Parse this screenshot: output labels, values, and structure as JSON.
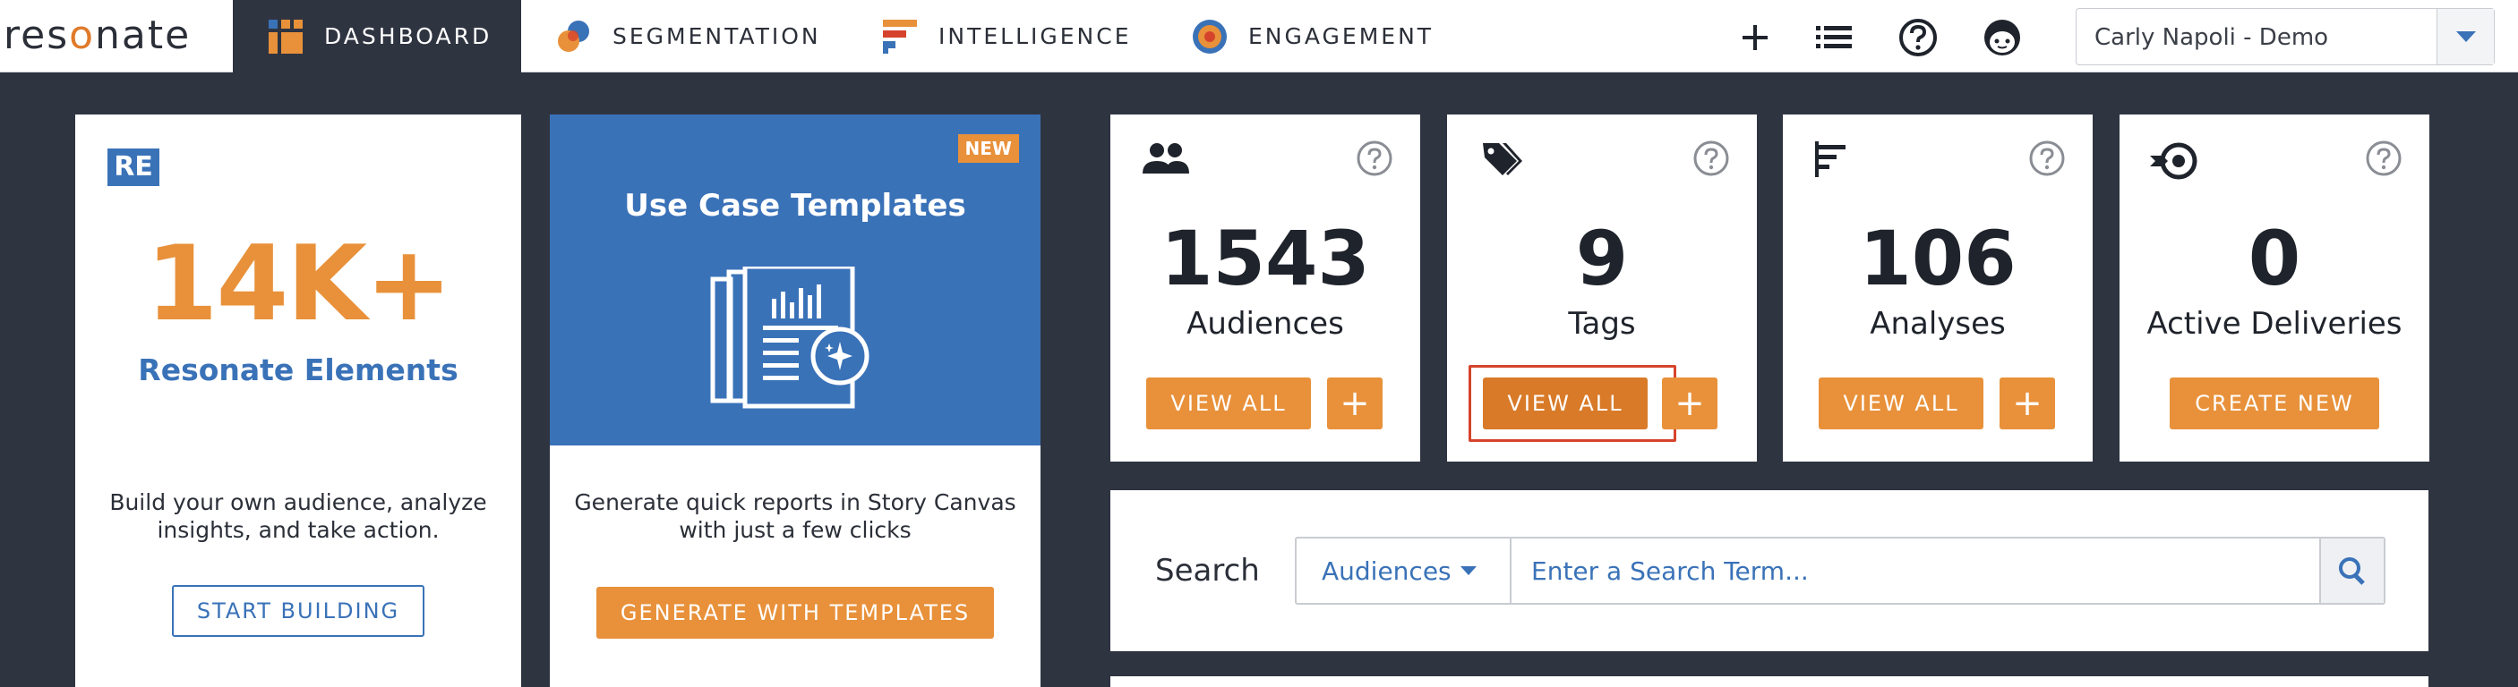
{
  "brand": {
    "logo_text_left": "res",
    "logo_text_o": "o",
    "logo_text_right": "nate"
  },
  "nav": {
    "tabs": [
      {
        "label": "DASHBOARD"
      },
      {
        "label": "SEGMENTATION"
      },
      {
        "label": "INTELLIGENCE"
      },
      {
        "label": "ENGAGEMENT"
      }
    ],
    "user_select_value": "Carly Napoli - Demo"
  },
  "elements_card": {
    "badge": "RE",
    "count": "14K+",
    "label": "Resonate Elements",
    "description": "Build your own audience, analyze insights, and take action.",
    "button": "START BUILDING"
  },
  "templates_card": {
    "badge": "NEW",
    "title": "Use Case Templates",
    "description": "Generate quick reports in Story Canvas with just a few clicks",
    "button": "GENERATE WITH TEMPLATES"
  },
  "stats": {
    "audiences": {
      "count": "1543",
      "label": "Audiences",
      "button": "VIEW ALL",
      "plus": "+"
    },
    "tags": {
      "count": "9",
      "label": "Tags",
      "button": "VIEW ALL",
      "plus": "+"
    },
    "analyses": {
      "count": "106",
      "label": "Analyses",
      "button": "VIEW ALL",
      "plus": "+"
    },
    "deliveries": {
      "count": "0",
      "label": "Active Deliveries",
      "button": "CREATE NEW"
    }
  },
  "search": {
    "label": "Search",
    "scope": "Audiences",
    "placeholder": "Enter a Search Term..."
  },
  "colors": {
    "accent_orange": "#e8913a",
    "brand_blue": "#3a72b8",
    "nav_dark": "#2f3441",
    "highlight_red": "#d6432c"
  }
}
